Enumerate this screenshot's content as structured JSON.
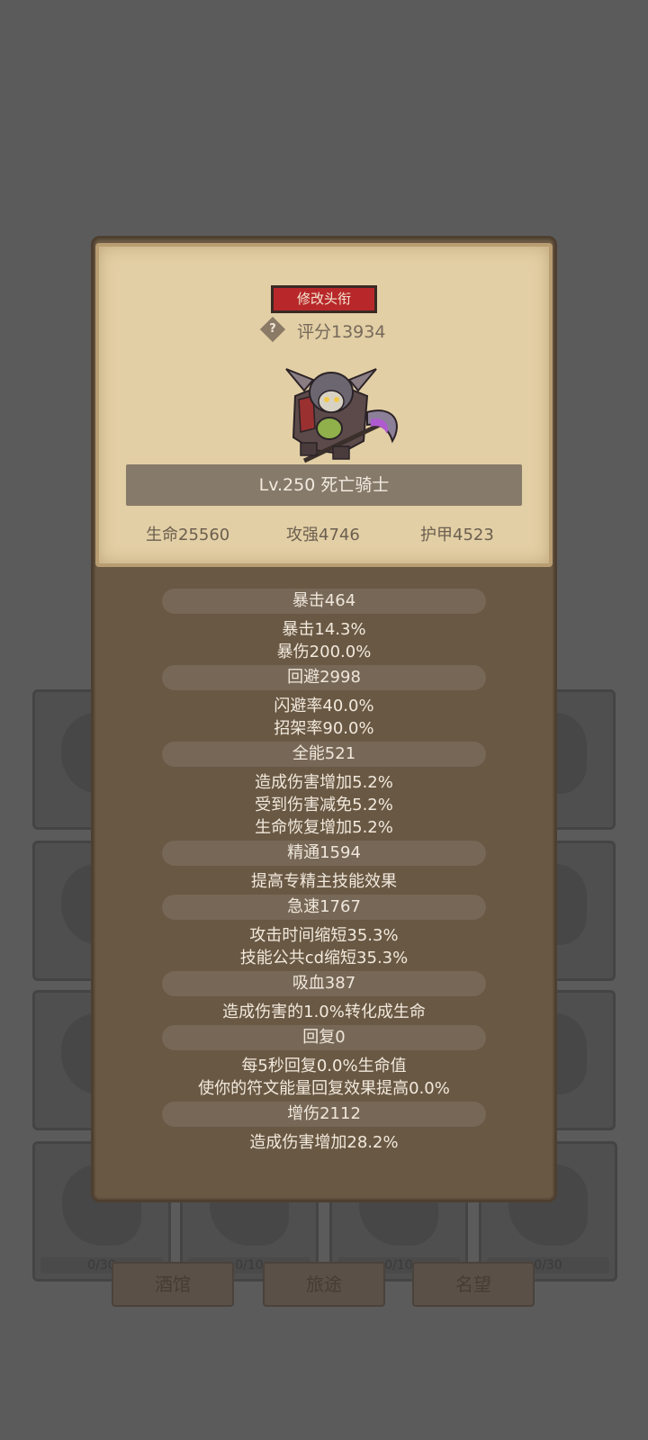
{
  "background": {
    "card_counts": [
      "0/30",
      "0/10",
      "0/10",
      "0/30"
    ],
    "buttons": [
      "酒馆",
      "旅途",
      "名望"
    ]
  },
  "hero_card": {
    "title_button": "修改头衔",
    "help_icon": "?",
    "score": "评分13934",
    "level_name": "Lv.250 死亡骑士",
    "hp": "生命25560",
    "attack": "攻强4746",
    "armor": "护甲4523"
  },
  "stats": {
    "crit": {
      "header": "暴击464",
      "lines": [
        "暴击14.3%",
        "暴伤200.0%"
      ]
    },
    "dodge": {
      "header": "回避2998",
      "lines": [
        "闪避率40.0%",
        "招架率90.0%"
      ]
    },
    "versatility": {
      "header": "全能521",
      "lines": [
        "造成伤害增加5.2%",
        "受到伤害减免5.2%",
        "生命恢复增加5.2%"
      ]
    },
    "mastery": {
      "header": "精通1594",
      "lines": [
        "提高专精主技能效果"
      ]
    },
    "haste": {
      "header": "急速1767",
      "lines": [
        "攻击时间缩短35.3%",
        "技能公共cd缩短35.3%"
      ]
    },
    "leech": {
      "header": "吸血387",
      "lines": [
        "造成伤害的1.0%转化成生命"
      ]
    },
    "regen": {
      "header": "回复0",
      "lines": [
        "每5秒回复0.0%生命值",
        "使你的符文能量回复效果提高0.0%"
      ]
    },
    "damage_bonus": {
      "header": "增伤2112",
      "lines": [
        "造成伤害增加28.2%"
      ]
    }
  },
  "colors": {
    "title_button": "#b8282a",
    "panel": "#695843",
    "card": "#e3cfa5"
  }
}
